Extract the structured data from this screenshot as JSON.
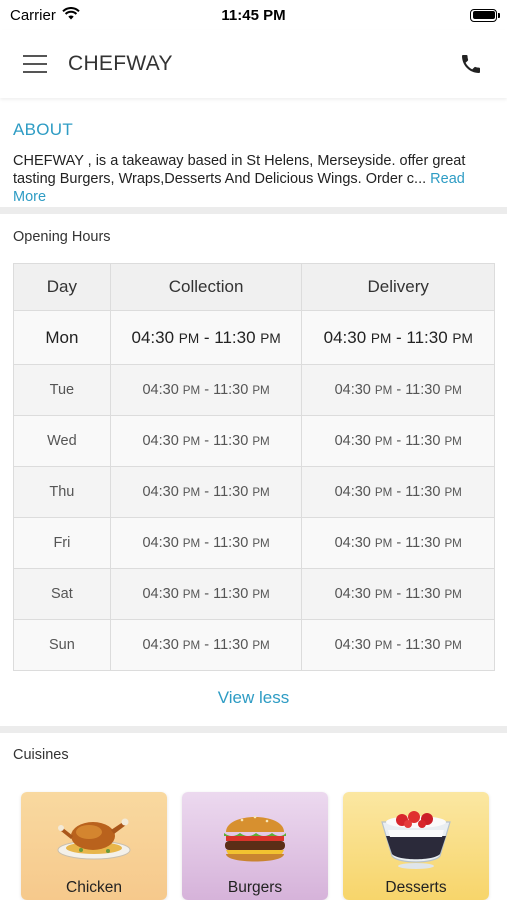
{
  "status_bar": {
    "carrier": "Carrier",
    "time": "11:45 PM"
  },
  "app_bar": {
    "title": "CHEFWAY"
  },
  "about": {
    "title": "ABOUT",
    "text": "CHEFWAY , is a takeaway based in St Helens, Merseyside. offer great tasting Burgers, Wraps,Desserts And Delicious Wings. Order c...",
    "read_more": "Read More"
  },
  "opening_hours": {
    "label": "Opening Hours",
    "headers": {
      "day": "Day",
      "collection": "Collection",
      "delivery": "Delivery"
    },
    "rows": [
      {
        "day": "Mon",
        "collection": {
          "from": "04:30",
          "from_period": "PM",
          "to": "11:30",
          "to_period": "PM"
        },
        "delivery": {
          "from": "04:30",
          "from_period": "PM",
          "to": "11:30",
          "to_period": "PM"
        }
      },
      {
        "day": "Tue",
        "collection": {
          "from": "04:30",
          "from_period": "PM",
          "to": "11:30",
          "to_period": "PM"
        },
        "delivery": {
          "from": "04:30",
          "from_period": "PM",
          "to": "11:30",
          "to_period": "PM"
        }
      },
      {
        "day": "Wed",
        "collection": {
          "from": "04:30",
          "from_period": "PM",
          "to": "11:30",
          "to_period": "PM"
        },
        "delivery": {
          "from": "04:30",
          "from_period": "PM",
          "to": "11:30",
          "to_period": "PM"
        }
      },
      {
        "day": "Thu",
        "collection": {
          "from": "04:30",
          "from_period": "PM",
          "to": "11:30",
          "to_period": "PM"
        },
        "delivery": {
          "from": "04:30",
          "from_period": "PM",
          "to": "11:30",
          "to_period": "PM"
        }
      },
      {
        "day": "Fri",
        "collection": {
          "from": "04:30",
          "from_period": "PM",
          "to": "11:30",
          "to_period": "PM"
        },
        "delivery": {
          "from": "04:30",
          "from_period": "PM",
          "to": "11:30",
          "to_period": "PM"
        }
      },
      {
        "day": "Sat",
        "collection": {
          "from": "04:30",
          "from_period": "PM",
          "to": "11:30",
          "to_period": "PM"
        },
        "delivery": {
          "from": "04:30",
          "from_period": "PM",
          "to": "11:30",
          "to_period": "PM"
        }
      },
      {
        "day": "Sun",
        "collection": {
          "from": "04:30",
          "from_period": "PM",
          "to": "11:30",
          "to_period": "PM"
        },
        "delivery": {
          "from": "04:30",
          "from_period": "PM",
          "to": "11:30",
          "to_period": "PM"
        }
      }
    ],
    "view_less": "View less"
  },
  "cuisines": {
    "label": "Cuisines",
    "items": [
      {
        "label": "Chicken",
        "icon": "roast-chicken-icon"
      },
      {
        "label": "Burgers",
        "icon": "burger-icon"
      },
      {
        "label": "Desserts",
        "icon": "dessert-icon"
      }
    ]
  },
  "colors": {
    "accent": "#2e9cc4",
    "divider": "#ececec",
    "header_bg": "#f0f0f0"
  }
}
